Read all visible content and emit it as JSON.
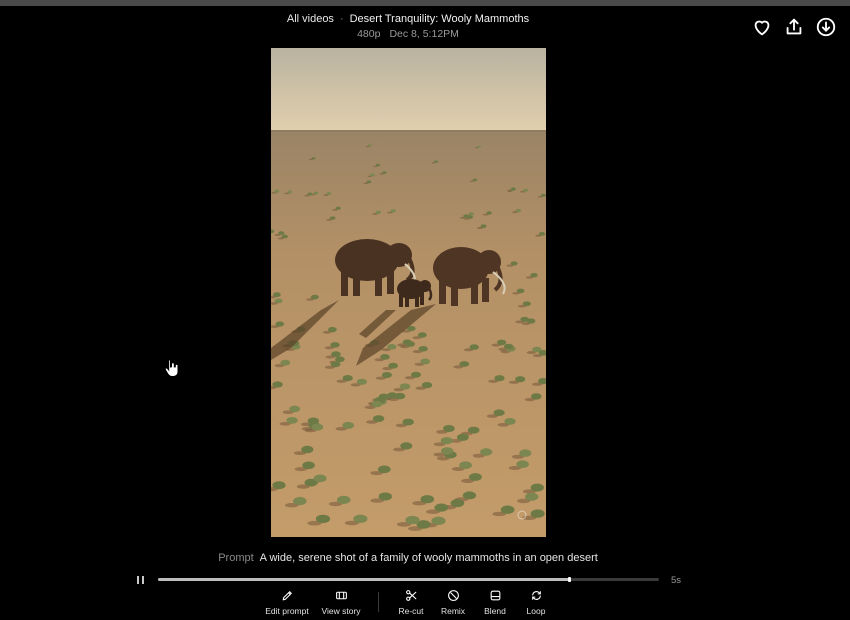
{
  "header": {
    "breadcrumb_link": "All videos",
    "separator": "·",
    "title": "Desert Tranquility: Wooly Mammoths",
    "resolution": "480p",
    "date": "Dec 8, 5:12PM"
  },
  "top_actions": {
    "favorite_icon": "heart-icon",
    "share_icon": "share-icon",
    "download_icon": "download-icon"
  },
  "video": {
    "description": "aerial desert scene with three wooly mammoths"
  },
  "prompt": {
    "label": "Prompt",
    "text": "A wide, serene shot of a family of wooly mammoths in an open desert"
  },
  "playback": {
    "state": "playing",
    "progress": 0.82,
    "duration": "5s"
  },
  "toolbar": {
    "edit_prompt": "Edit prompt",
    "view_story": "View story",
    "recut": "Re-cut",
    "remix": "Remix",
    "blend": "Blend",
    "loop": "Loop"
  },
  "colors": {
    "background": "#000000",
    "sky": "#c9b9a0",
    "sand": "#b08a5e",
    "text": "#ffffff",
    "muted": "#9a9a9a"
  }
}
